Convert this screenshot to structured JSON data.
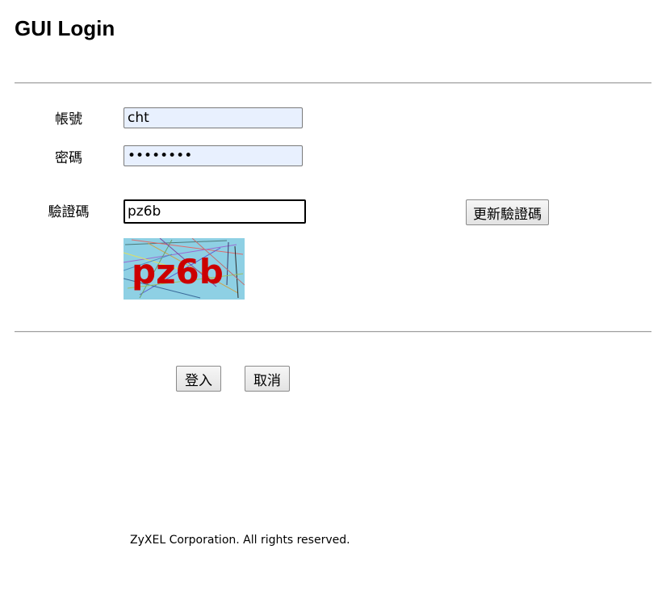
{
  "page": {
    "title": "GUI Login",
    "footer": "ZyXEL Corporation. All rights reserved."
  },
  "form": {
    "username_label": "帳號",
    "username_value": "cht",
    "password_label": "密碼",
    "password_value": "********",
    "captcha_label": "驗證碼",
    "captcha_value": "pz6b",
    "refresh_button": "更新驗證碼",
    "captcha_image_text": "pz6b"
  },
  "actions": {
    "login_button": "登入",
    "cancel_button": "取消"
  },
  "colors": {
    "autofill_background": "#e8f0fe",
    "captcha_background": "#8ed0e4",
    "captcha_text": "#cc0000"
  }
}
